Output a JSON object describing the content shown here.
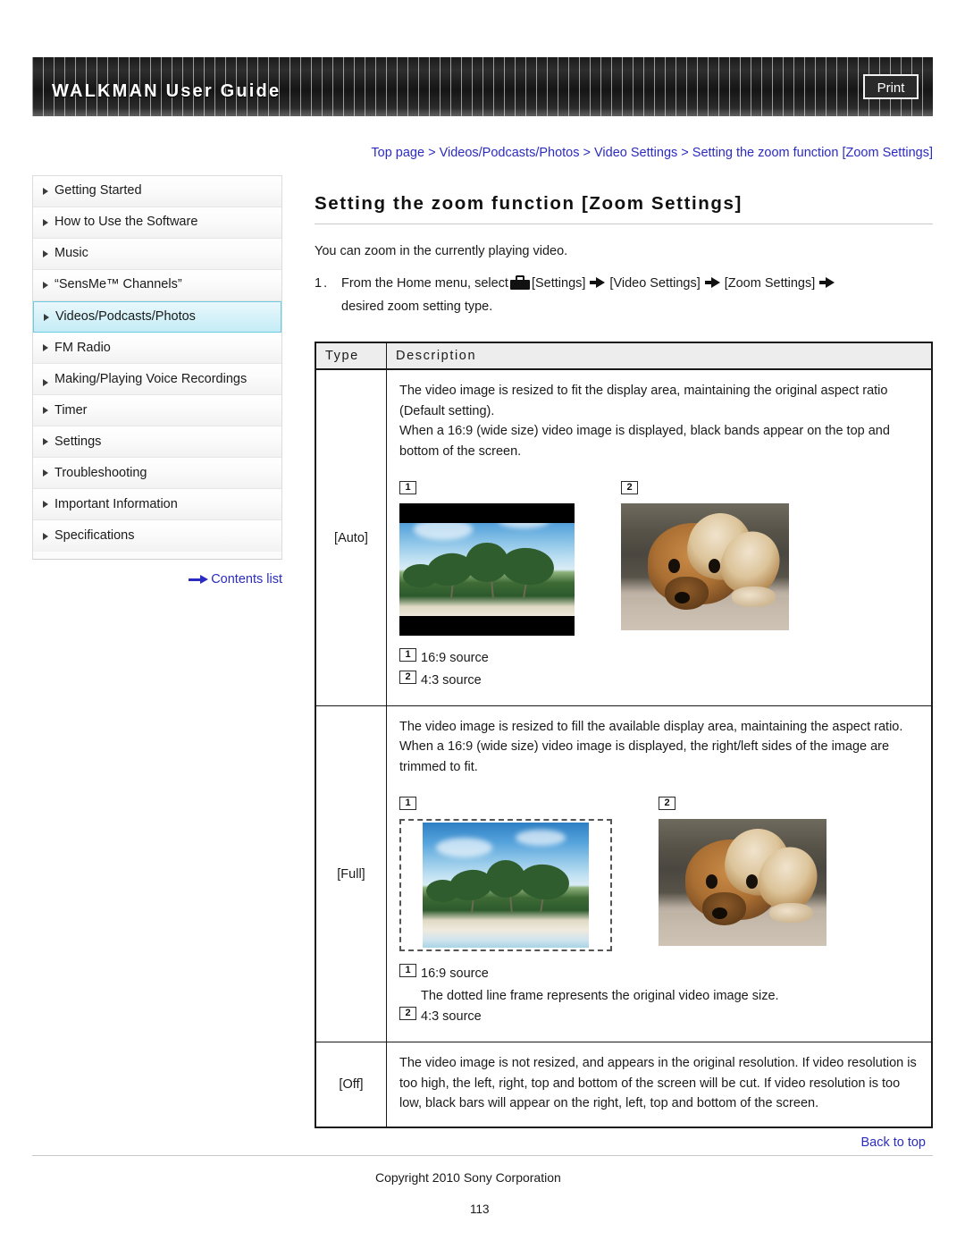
{
  "header": {
    "title": "WALKMAN User Guide",
    "print_label": "Print"
  },
  "sidebar": {
    "items": [
      {
        "label": "Getting Started",
        "selected": false
      },
      {
        "label": "How to Use the Software",
        "selected": false
      },
      {
        "label": "Music",
        "selected": false
      },
      {
        "label": "“SensMe™ Channels”",
        "selected": false
      },
      {
        "label": "Videos/Podcasts/Photos",
        "selected": true
      },
      {
        "label": "FM Radio",
        "selected": false
      },
      {
        "label": "Making/Playing Voice Recordings",
        "selected": false
      },
      {
        "label": "Timer",
        "selected": false
      },
      {
        "label": "Settings",
        "selected": false
      },
      {
        "label": "Troubleshooting",
        "selected": false
      },
      {
        "label": "Important Information",
        "selected": false
      },
      {
        "label": "Specifications",
        "selected": false
      }
    ],
    "contents_link": "Contents list"
  },
  "main": {
    "breadcrumb": "Top page > Videos/Podcasts/Photos > Video Settings > Setting the zoom function [Zoom Settings]",
    "title": "Setting the zoom function [Zoom Settings]",
    "intro": "You can zoom in the currently playing video.",
    "step": {
      "number": "1.",
      "text_before_icon": "From the Home menu, select",
      "settings_label": "[Settings]",
      "video_settings_label": "[Video Settings]",
      "zoom_settings_label": "[Zoom Settings]",
      "text_after": "desired zoom setting type."
    },
    "table": {
      "headers": {
        "type": "Type",
        "description": "Description"
      },
      "rows": [
        {
          "type": "[Auto]",
          "description_lines": [
            "The video image is resized to fit the display area, maintaining the original aspect ratio (Default setting).",
            "When a 16:9 (wide size) video image is displayed, black bands appear on the top and bottom of the screen."
          ],
          "figures": [
            {
              "badge": "1",
              "kind": "beach-letterbox"
            },
            {
              "badge": "2",
              "kind": "dog"
            }
          ],
          "captions": [
            {
              "badge": "1",
              "text": "16:9 source",
              "sub": ""
            },
            {
              "badge": "2",
              "text": "4:3 source",
              "sub": ""
            }
          ]
        },
        {
          "type": "[Full]",
          "description_lines": [
            "The video image is resized to fill the available display area, maintaining the aspect ratio.",
            "When a 16:9 (wide size) video image is displayed, the right/left sides of the image are trimmed to fit."
          ],
          "figures": [
            {
              "badge": "1",
              "kind": "beach-dashed"
            },
            {
              "badge": "2",
              "kind": "dog"
            }
          ],
          "captions": [
            {
              "badge": "1",
              "text": "16:9 source",
              "sub": "The dotted line frame represents the original video image size."
            },
            {
              "badge": "2",
              "text": "4:3 source",
              "sub": ""
            }
          ]
        },
        {
          "type": "[Off]",
          "description_lines": [
            "The video image is not resized, and appears in the original resolution. If video resolution is too high, the left, right, top and bottom of the screen will be cut. If video resolution is too low, black bars will appear on the right, left, top and bottom of the screen."
          ],
          "figures": [],
          "captions": []
        }
      ]
    }
  },
  "footer": {
    "back_to_top": "Back to top",
    "copyright": "Copyright 2010 Sony Corporation",
    "page_number": "113"
  },
  "colors": {
    "link": "#2b2bc0",
    "selected_nav": "#c5ecf6",
    "selected_nav_border": "#6dcbe0",
    "banner": "#1b1b1b",
    "table_header": "#ededed"
  }
}
